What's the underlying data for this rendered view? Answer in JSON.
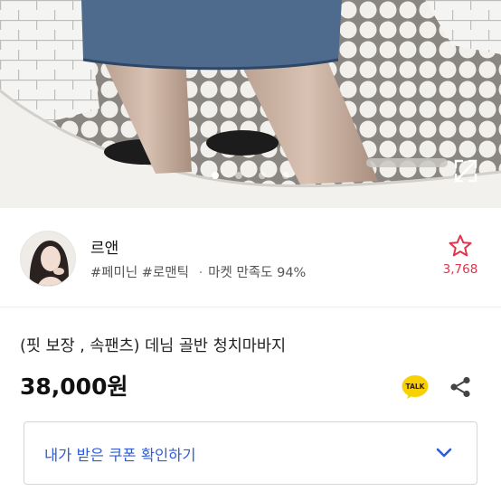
{
  "image_carousel": {
    "page_count": 4,
    "active_index": 0
  },
  "seller": {
    "name": "르앤",
    "tags": [
      "#페미닌",
      "#로맨틱"
    ],
    "separator": "·",
    "satisfaction": "마켓 만족도 94%",
    "favorite_count": "3,768"
  },
  "product": {
    "title": "(핏 보장 , 속팬츠) 데님 골반 청치마바지",
    "price": "38,000원"
  },
  "kakao_button": {
    "label": "TALK"
  },
  "coupon": {
    "label": "내가 받은 쿠폰 확인하기"
  },
  "colors": {
    "accent_red": "#e0344c",
    "coupon_blue": "#2f5bd8",
    "kakao_yellow": "#f7d100"
  },
  "icons": [
    "expand-icon",
    "star-icon",
    "kakao-talk-icon",
    "share-icon",
    "chevron-down-icon"
  ]
}
